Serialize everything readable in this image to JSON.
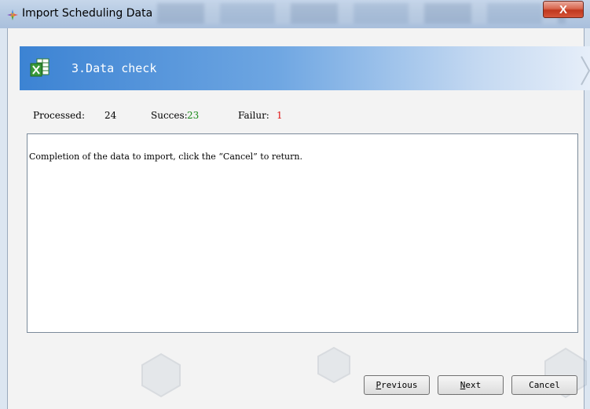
{
  "window": {
    "title": "Import Scheduling Data",
    "close_label": "X"
  },
  "step": {
    "title": "3.Data check"
  },
  "stats": {
    "processed_label": "Processed:",
    "processed_value": "24",
    "success_label": "Succes:",
    "success_value": "23",
    "failure_label": "Failur:",
    "failure_value": "1"
  },
  "message": "Completion of the data to import, click the “Cancel” to return.",
  "buttons": {
    "previous_first": "P",
    "previous_rest": "revious",
    "next_first": "N",
    "next_rest": "ext",
    "cancel": "Cancel"
  },
  "colors": {
    "success": "#1a8a1a",
    "failure": "#e01010",
    "banner": "#3c83d3"
  },
  "icons": {
    "app": "app-icon",
    "banner": "excel-icon",
    "close": "close-icon"
  }
}
